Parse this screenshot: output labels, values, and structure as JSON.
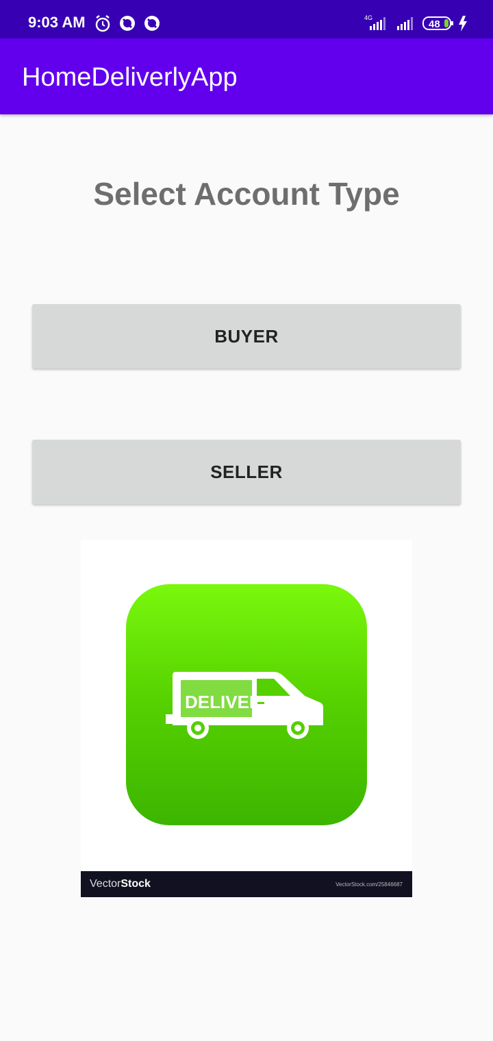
{
  "status_bar": {
    "time": "9:03 AM",
    "network": "4G",
    "battery": "48",
    "icons": [
      "alarm-icon",
      "notification-icon",
      "notification-icon",
      "signal-icon",
      "signal-icon",
      "battery-icon",
      "charging-icon"
    ]
  },
  "app_bar": {
    "title": "HomeDeliverlyApp"
  },
  "main": {
    "heading": "Select Account Type",
    "buyer_label": "BUYER",
    "seller_label": "SELLER",
    "image": {
      "van_label": "DELIVERY",
      "watermark_brand_light": "Vector",
      "watermark_brand_bold": "Stock",
      "watermark_url": "VectorStock.com/25846687"
    }
  },
  "colors": {
    "status_bar": "#3700b3",
    "app_bar": "#6200ee",
    "button": "#d7d8d8",
    "tile_green": "#55d000"
  }
}
